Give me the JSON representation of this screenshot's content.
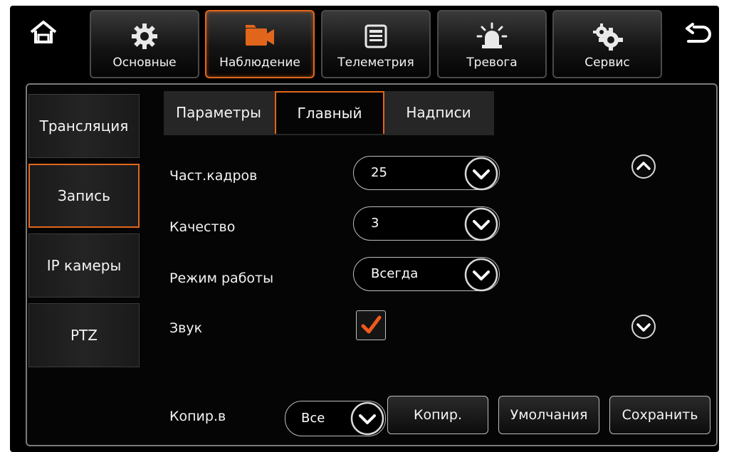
{
  "top_tabs": [
    {
      "label": "Основные",
      "icon": "gear-icon",
      "active": false
    },
    {
      "label": "Наблюдение",
      "icon": "video-camera-icon",
      "active": true
    },
    {
      "label": "Телеметрия",
      "icon": "document-icon",
      "active": false
    },
    {
      "label": "Тревога",
      "icon": "alarm-light-icon",
      "active": false
    },
    {
      "label": "Сервис",
      "icon": "gears-icon",
      "active": false
    }
  ],
  "side_tabs": [
    {
      "label": "Трансляция",
      "active": false
    },
    {
      "label": "Запись",
      "active": true
    },
    {
      "label": "IP камеры",
      "active": false
    },
    {
      "label": "PTZ",
      "active": false
    }
  ],
  "sub_tabs": [
    {
      "label": "Параметры",
      "active": false
    },
    {
      "label": "Главный",
      "active": true
    },
    {
      "label": "Надписи",
      "active": false
    }
  ],
  "form": {
    "frame_rate": {
      "label": "Част.кадров",
      "value": "25"
    },
    "quality": {
      "label": "Качество",
      "value": "3"
    },
    "mode": {
      "label": "Режим работы",
      "value": "Всегда"
    },
    "sound": {
      "label": "Звук",
      "checked": true
    }
  },
  "footer": {
    "copy_to_label": "Копир.в",
    "copy_to_value": "Все",
    "copy_button": "Копир.",
    "defaults_button": "Умолчания",
    "save_button": "Сохранить"
  },
  "colors": {
    "accent": "#e1661c",
    "background": "#000000"
  }
}
